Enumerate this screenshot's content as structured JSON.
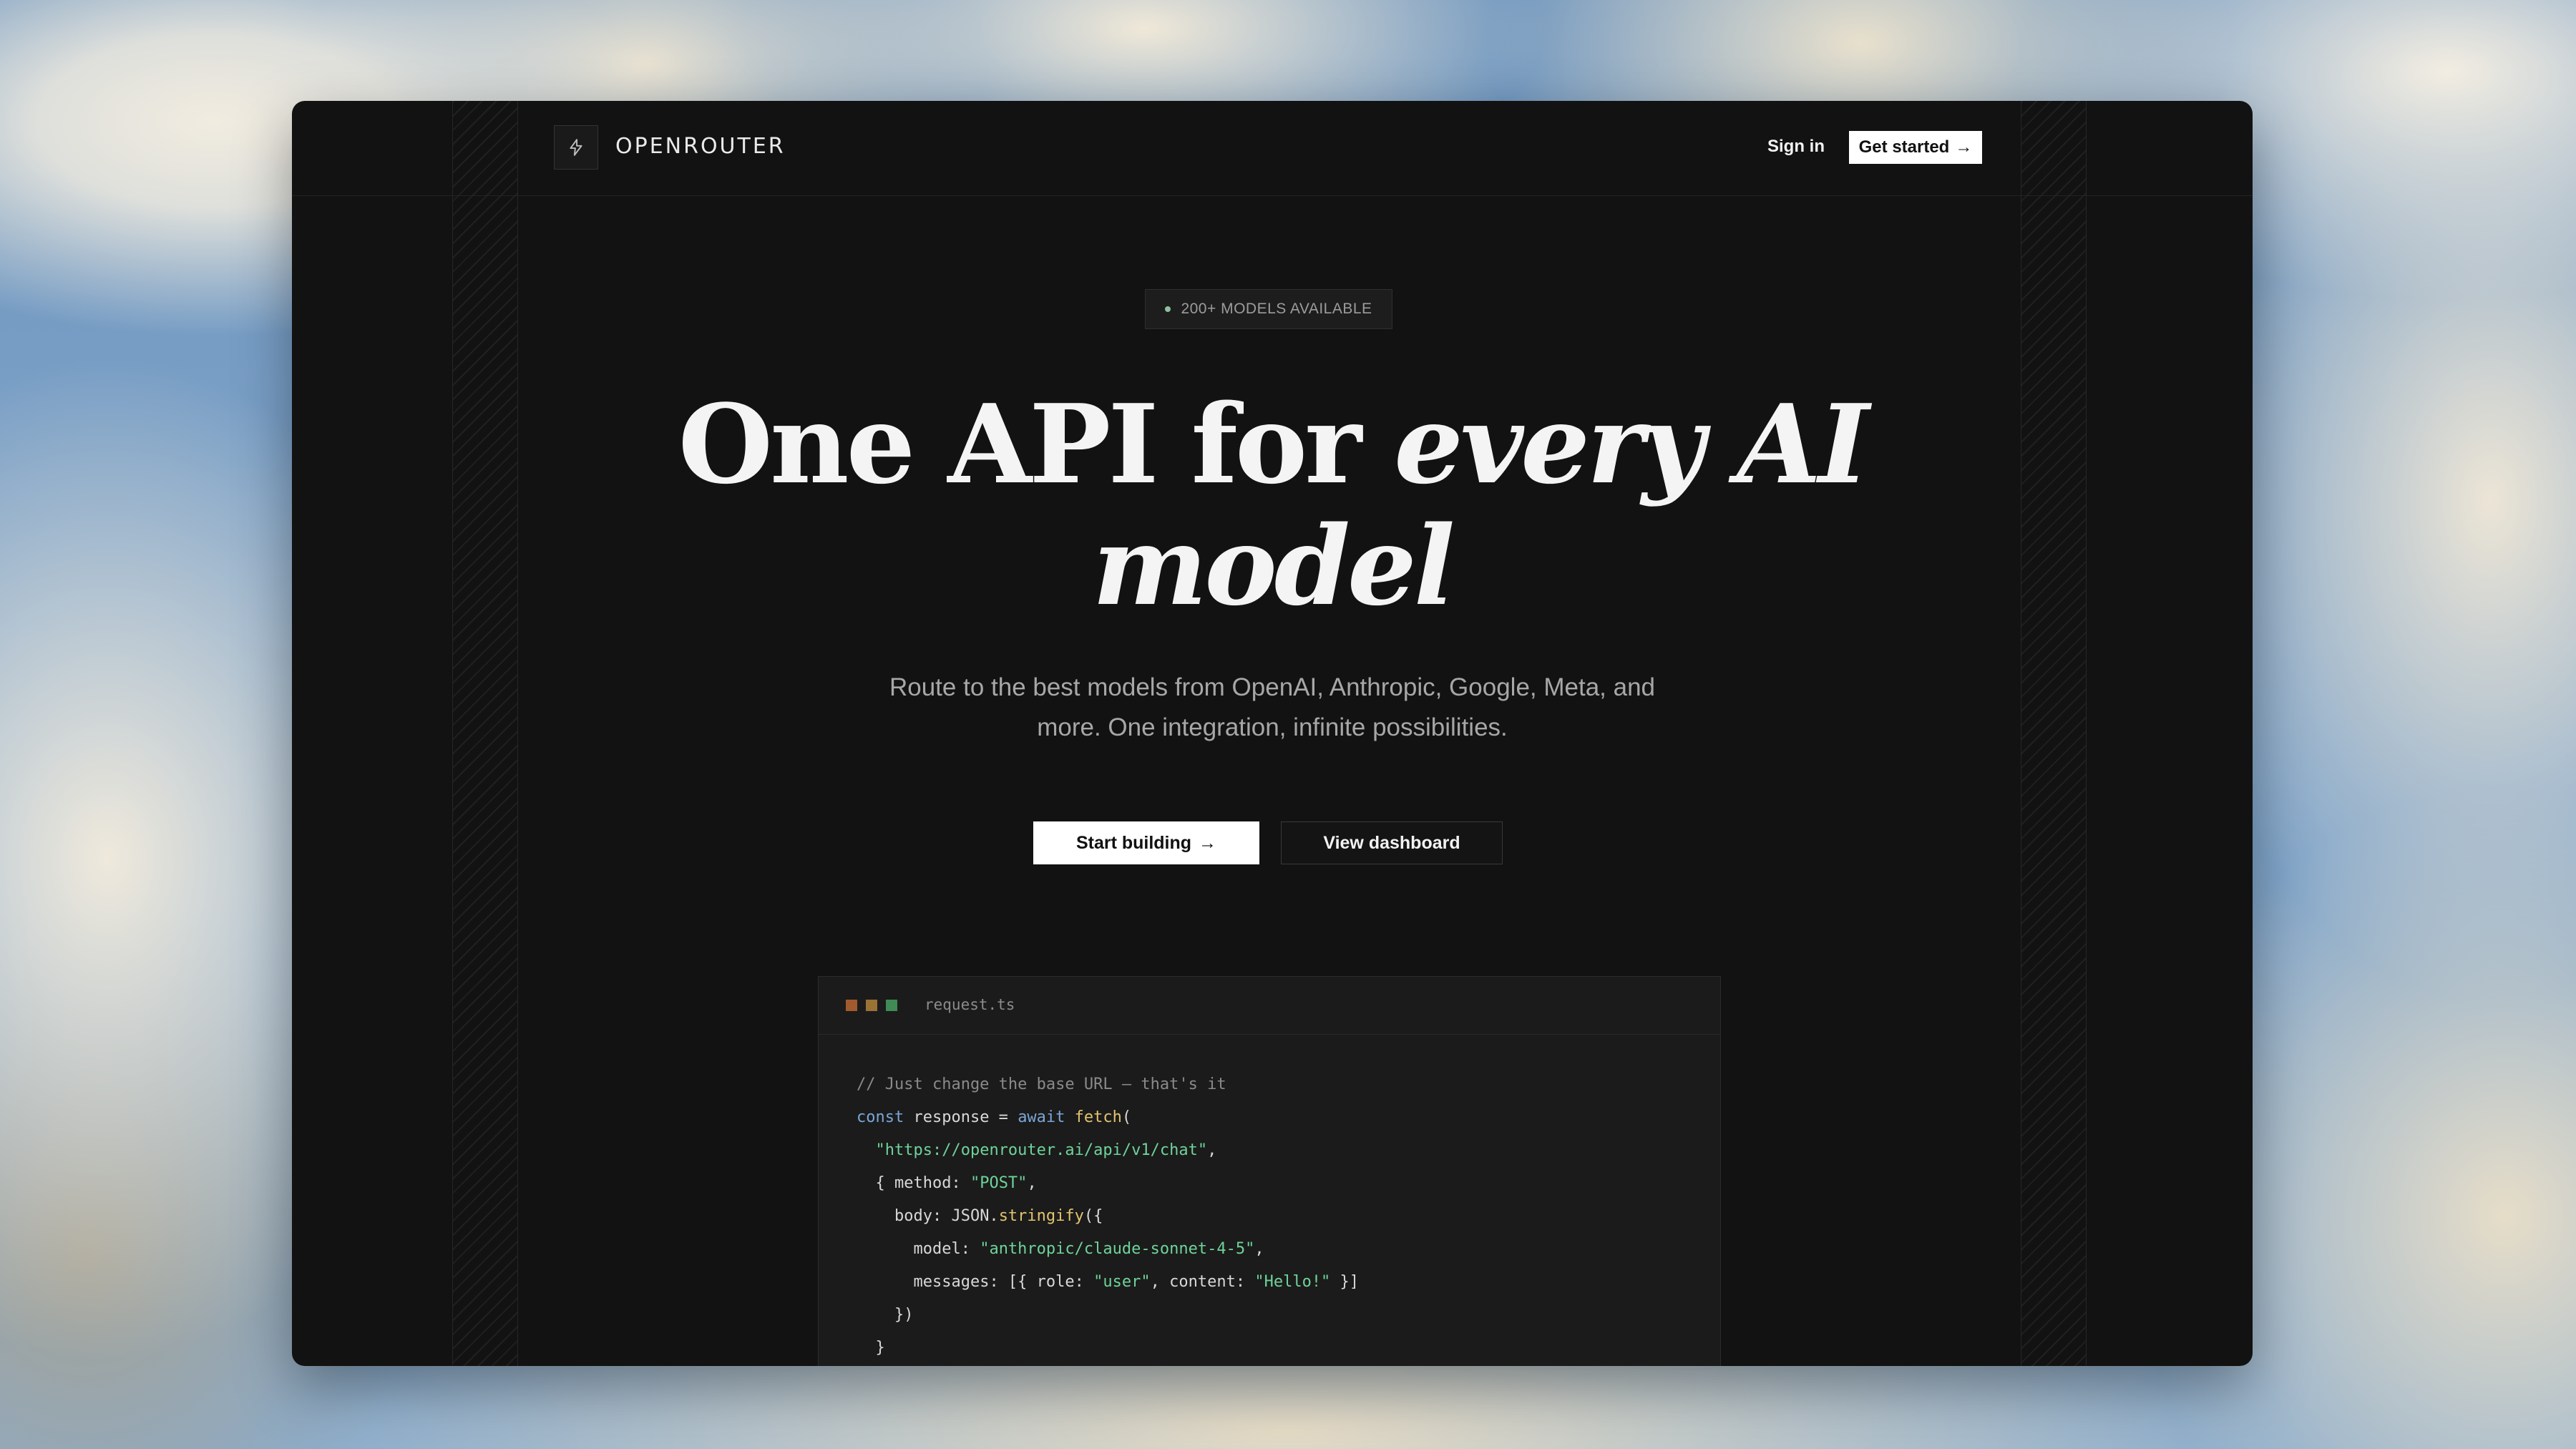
{
  "nav": {
    "brand": "OPENROUTER",
    "sign_in": "Sign in",
    "get_started": "Get started",
    "arrow": "→"
  },
  "hero": {
    "badge": "200+ MODELS AVAILABLE",
    "headline_plain": "One API for ",
    "headline_italic_1": "every AI",
    "headline_italic_2": "model",
    "subtitle_line1": "Route to the best models from OpenAI, Anthropic, Google, Meta, and",
    "subtitle_line2": "more. One integration, infinite possibilities.",
    "cta_primary": "Start building",
    "cta_secondary": "View dashboard"
  },
  "code": {
    "filename": "request.ts",
    "comment": "// Just change the base URL — that's it",
    "kw_const": "const",
    "var_response": " response = ",
    "kw_await": "await",
    "fn_fetch": "fetch",
    "paren_open": "(",
    "url": "\"https://openrouter.ai/api/v1/chat\"",
    "comma": ",",
    "method_prefix": "{ method: ",
    "method_value": "\"POST\"",
    "body_prefix": "body: JSON.",
    "fn_stringify": "stringify",
    "body_open": "({",
    "model_prefix": "model: ",
    "model_value": "\"anthropic/claude-sonnet-4-5\"",
    "messages_prefix": "messages: [{ role: ",
    "role_value": "\"user\"",
    "content_prefix": ", content: ",
    "content_value": "\"Hello!\"",
    "messages_close": " }]",
    "body_close": "})",
    "obj_close": "}"
  },
  "colors": {
    "window_bg": "#121212",
    "accent_green": "#6fd39a",
    "keyword_blue": "#7aa6d6",
    "function_yellow": "#e3c36e"
  },
  "icons": {
    "logo": "lightning-bolt-icon",
    "arrow": "arrow-right-icon"
  }
}
